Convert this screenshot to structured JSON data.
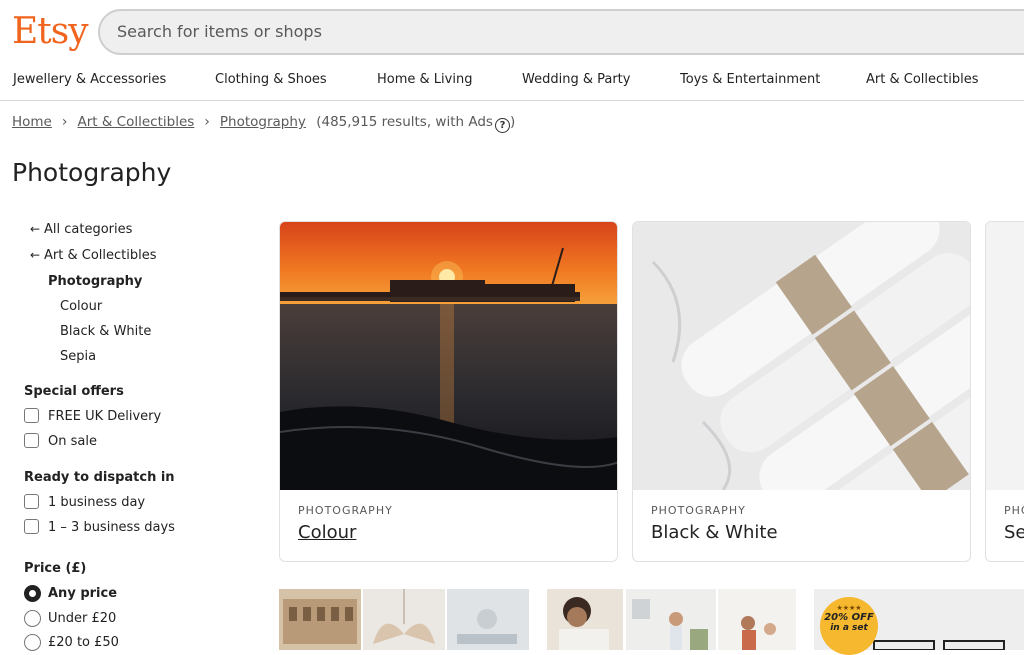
{
  "header": {
    "logo": "Etsy",
    "search_placeholder": "Search for items or shops"
  },
  "nav": {
    "items": [
      "Jewellery & Accessories",
      "Clothing & Shoes",
      "Home & Living",
      "Wedding & Party",
      "Toys & Entertainment",
      "Art & Collectibles"
    ]
  },
  "breadcrumb": {
    "home": "Home",
    "parent": "Art & Collectibles",
    "current": "Photography",
    "results": "(485,915 results, with Ads",
    "results_end": ")"
  },
  "page_title": "Photography",
  "sidebar": {
    "all_categories": "All categories",
    "parent_category": "Art & Collectibles",
    "current_category": "Photography",
    "subcategories": [
      "Colour",
      "Black & White",
      "Sepia"
    ],
    "special_offers": {
      "heading": "Special offers",
      "options": [
        {
          "label": "FREE UK Delivery",
          "checked": false
        },
        {
          "label": "On sale",
          "checked": false
        }
      ]
    },
    "dispatch": {
      "heading": "Ready to dispatch in",
      "options": [
        {
          "label": "1 business day",
          "checked": false
        },
        {
          "label": "1 – 3 business days",
          "checked": false
        }
      ]
    },
    "price": {
      "heading": "Price (£)",
      "options": [
        {
          "label": "Any price",
          "selected": true
        },
        {
          "label": "Under £20",
          "selected": false
        },
        {
          "label": "£20 to £50",
          "selected": false
        }
      ]
    }
  },
  "category_cards": [
    {
      "category": "PHOTOGRAPHY",
      "name": "Colour"
    },
    {
      "category": "PHOTOGRAPHY",
      "name": "Black & White"
    },
    {
      "category": "PHO",
      "name": "Se"
    }
  ],
  "promo_badge": {
    "line1": "20% OFF",
    "line2": "in a set"
  },
  "colors": {
    "brand": "#f1641e",
    "badge": "#f5b82e"
  }
}
